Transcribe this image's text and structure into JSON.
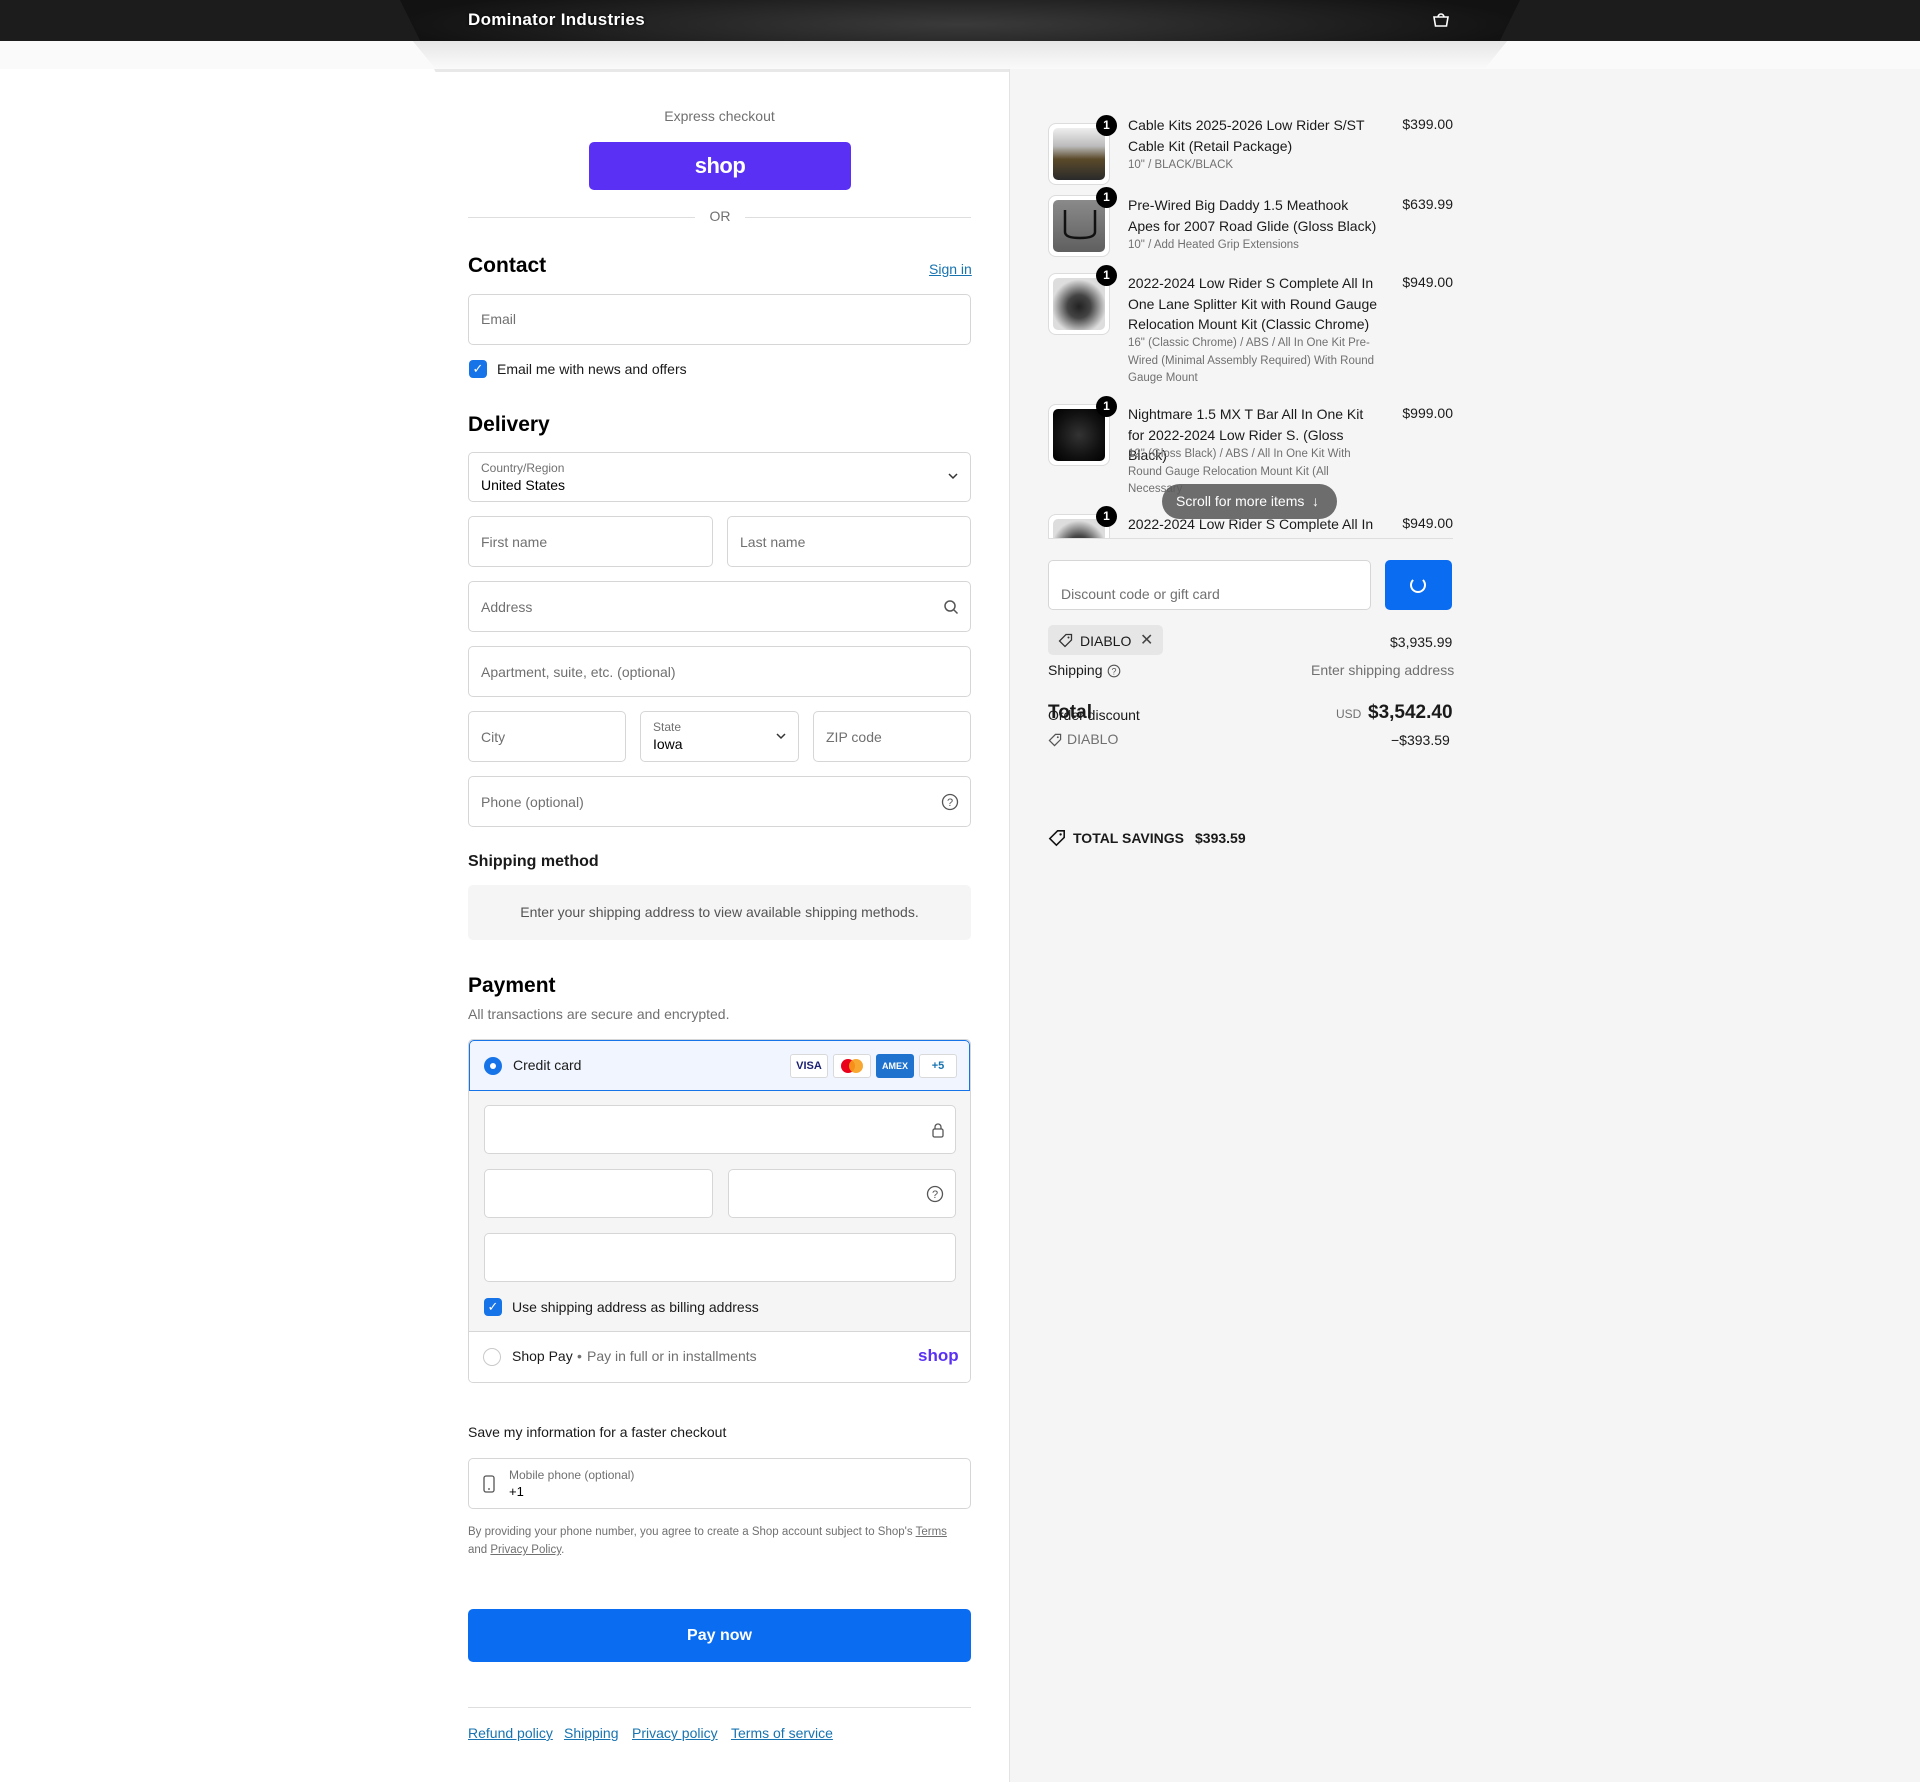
{
  "header": {
    "brand": "Dominator Industries",
    "cart_icon": "shopping-bag-icon"
  },
  "express": {
    "title": "Express checkout",
    "shop_button": "shop",
    "or": "OR"
  },
  "contact": {
    "title": "Contact",
    "sign_in": "Sign in",
    "email_placeholder": "Email",
    "news_label": "Email me with news and offers"
  },
  "delivery": {
    "title": "Delivery",
    "country_label": "Country/Region",
    "country_value": "United States",
    "first_name": "First name",
    "last_name": "Last name",
    "address": "Address",
    "apartment": "Apartment, suite, etc. (optional)",
    "city": "City",
    "state_label": "State",
    "state_value": "Iowa",
    "zip": "ZIP code",
    "phone": "Phone (optional)"
  },
  "shipping_method": {
    "title": "Shipping method",
    "info": "Enter your shipping address to view available shipping methods."
  },
  "payment": {
    "title": "Payment",
    "subtitle": "All transactions are secure and encrypted.",
    "credit_card": "Credit card",
    "cards": [
      "VISA",
      "MC",
      "AMEX",
      "+5"
    ],
    "billing_label": "Use shipping address as billing address",
    "shop_pay": "Shop Pay",
    "shop_pay_desc": "Pay in full or in installments",
    "shop_pay_logo": "shop"
  },
  "save_info": {
    "title": "Save my information for a faster checkout",
    "mobile_label": "Mobile phone (optional)",
    "mobile_value": "+1",
    "legal_prefix": "By providing your phone number, you agree to create a Shop account subject to Shop's",
    "terms": "Terms",
    "and": "and",
    "privacy": "Privacy Policy",
    "period": "."
  },
  "pay_now": "Pay now",
  "footer": {
    "links": [
      "Refund policy",
      "Shipping",
      "Privacy policy",
      "Terms of service"
    ]
  },
  "order": {
    "items": [
      {
        "qty": "1",
        "title": "Cable Kits 2025-2026 Low Rider S/ST Cable Kit (Retail Package)",
        "variant": "10\" / BLACK/BLACK",
        "price": "$399.00"
      },
      {
        "qty": "1",
        "title": "Pre-Wired Big Daddy 1.5 Meathook Apes for 2007 Road Glide (Gloss Black)",
        "variant": "10\" / Add Heated Grip Extensions",
        "price": "$639.99"
      },
      {
        "qty": "1",
        "title": "2022-2024 Low Rider S Complete All In One Lane Splitter Kit with Round Gauge Relocation Mount Kit (Classic Chrome)",
        "variant": "16\" (Classic Chrome) / ABS / All In One Kit Pre-Wired (Minimal Assembly Required) With Round Gauge Mount",
        "price": "$949.00"
      },
      {
        "qty": "1",
        "title": "Nightmare 1.5 MX T Bar All In One Kit for 2022-2024 Low Rider S. (Gloss Black)",
        "variant": "12\" (Gloss Black) / ABS / All In One Kit With Round Gauge Relocation Mount Kit (All Necessary",
        "price": "$999.00"
      },
      {
        "qty": "1",
        "title": "2022-2024 Low Rider S Complete All In",
        "variant": "",
        "price": "$949.00"
      }
    ],
    "scroll_hint": "Scroll for more items",
    "discount_placeholder": "Discount code or gift card",
    "applied_code": "DIABLO",
    "subtotal": "$3,935.99",
    "shipping_label": "Shipping",
    "shipping_value": "Enter shipping address",
    "total_label": "Total",
    "order_discount_label": "Order discount",
    "currency": "USD",
    "total_value": "$3,542.40",
    "discount_code": "DIABLO",
    "discount_value": "−$393.59",
    "savings_label": "TOTAL SAVINGS",
    "savings_value": "$393.59"
  }
}
